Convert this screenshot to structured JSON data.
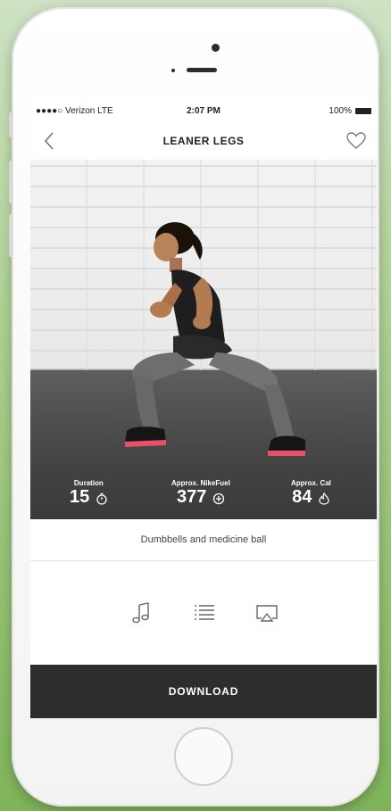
{
  "status_bar": {
    "carrier": "●●●●○ Verizon  LTE",
    "time": "2:07 PM",
    "battery": "100%"
  },
  "nav": {
    "title": "LEANER LEGS"
  },
  "hero": {
    "stats": [
      {
        "label": "Duration",
        "value": "15",
        "icon": "stopwatch-icon"
      },
      {
        "label": "Approx. NikeFuel",
        "value": "377",
        "icon": "fuel-plus-icon"
      },
      {
        "label": "Approx. Cal",
        "value": "84",
        "icon": "flame-icon"
      }
    ]
  },
  "equipment": "Dumbbells and medicine ball",
  "actions": {
    "download": "DOWNLOAD"
  },
  "colors": {
    "download_bg": "#2d2d2d",
    "accent_shoe": "#e8506a"
  }
}
